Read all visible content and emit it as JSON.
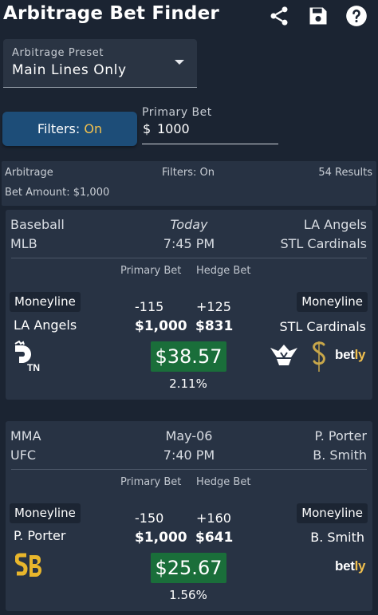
{
  "app": {
    "title": "Arbitrage Bet Finder"
  },
  "toolbar": {
    "icons": [
      "share-icon",
      "save-icon",
      "help-icon"
    ]
  },
  "preset": {
    "label": "Arbitrage Preset",
    "value": "Main Lines Only"
  },
  "filters": {
    "label": "Filters:",
    "state": "On"
  },
  "primary_bet": {
    "label": "Primary Bet",
    "currency": "$",
    "value": "1000"
  },
  "summary": {
    "type": "Arbitrage",
    "filters": "Filters: On",
    "results": "54 Results",
    "bet_amount": "Bet Amount: $1,000"
  },
  "col_headers": {
    "primary": "Primary Bet",
    "hedge": "Hedge Bet"
  },
  "colors": {
    "background": "#1b2432",
    "card": "#283344",
    "profit": "#1a6e3a",
    "accent": "#f2c14e",
    "button": "#1d4d78"
  },
  "cards": [
    {
      "sport": "Baseball",
      "league": "MLB",
      "date": "Today",
      "time": "7:45 PM",
      "team_top": "LA Angels",
      "team_bottom": "STL Cardinals",
      "left_market": "Moneyline",
      "left_team": "LA Angels",
      "right_market": "Moneyline",
      "right_team": "STL Cardinals",
      "primary_odds": "-115",
      "primary_amount": "$1,000",
      "hedge_odds": "+125",
      "hedge_amount": "$831",
      "profit": "$38.57",
      "percent": "2.11%",
      "left_books": [
        "draftkings-tn-logo"
      ],
      "right_books": [
        "wynnbet-logo",
        "sportsbook-s-logo",
        "betly-logo"
      ],
      "betly_text": "bet",
      "betly_accent": "ly"
    },
    {
      "sport": "MMA",
      "league": "UFC",
      "date": "May-06",
      "time": "7:40 PM",
      "team_top": "P. Porter",
      "team_bottom": "B. Smith",
      "left_market": "Moneyline",
      "left_team": "P. Porter",
      "right_market": "Moneyline",
      "right_team": "B. Smith",
      "primary_odds": "-150",
      "primary_amount": "$1,000",
      "hedge_odds": "+160",
      "hedge_amount": "$641",
      "profit": "$25.67",
      "percent": "1.56%",
      "left_books": [
        "superbook-sb-logo"
      ],
      "right_books": [
        "betly-logo"
      ],
      "betly_text": "bet",
      "betly_accent": "ly"
    }
  ]
}
